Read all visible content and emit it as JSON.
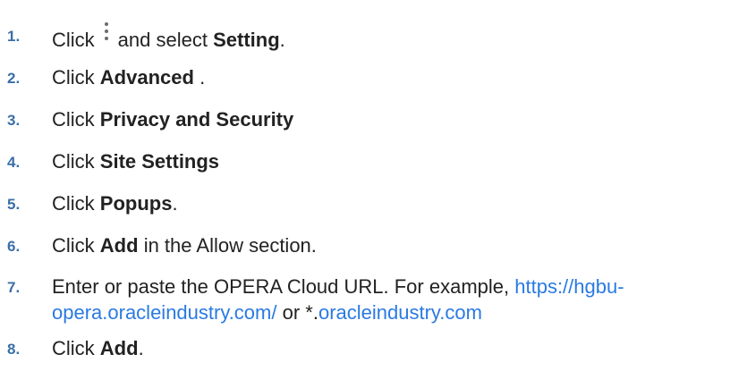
{
  "steps": [
    {
      "number": "1.",
      "prefix": "Click",
      "icon": "more-vert-icon",
      "mid": "and select",
      "bold": "Setting",
      "suffix": "."
    },
    {
      "number": "2.",
      "prefix": "Click",
      "bold": "Advanced",
      "suffix": "."
    },
    {
      "number": "3.",
      "prefix": "Click",
      "bold": "Privacy and Security"
    },
    {
      "number": "4.",
      "prefix": "Click",
      "bold": "Site Settings"
    },
    {
      "number": "5.",
      "prefix": "Click",
      "bold": "Popups",
      "suffix": "."
    },
    {
      "number": "6.",
      "prefix": "Click",
      "bold": "Add",
      "suffix": "in the Allow section."
    },
    {
      "number": "7.",
      "text": "Enter or paste the OPERA Cloud URL. For example,",
      "link1_line1": "https://hgbu-",
      "link1_line2": "opera.oracleindustry.com/",
      "or": "or *.",
      "link2": "oracleindustry.com"
    },
    {
      "number": "8.",
      "prefix": "Click",
      "bold": "Add",
      "suffix": "."
    }
  ]
}
